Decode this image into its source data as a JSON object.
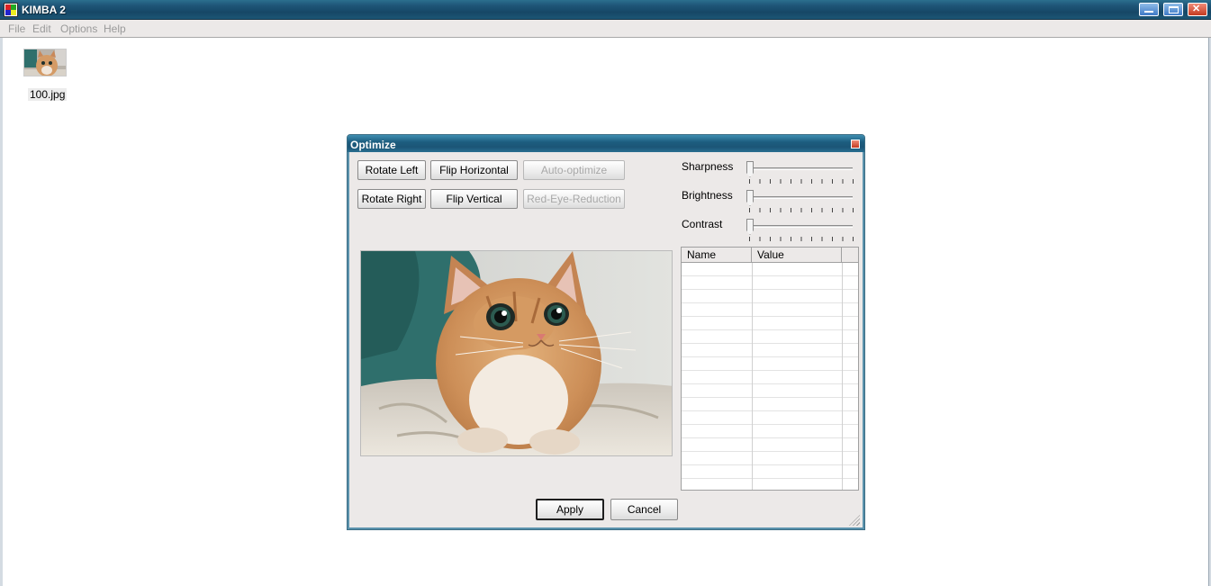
{
  "window": {
    "title": "KIMBA 2",
    "controls": {
      "minimize": "minimize-icon",
      "maximize": "maximize-icon",
      "close": "close-icon"
    }
  },
  "menu": {
    "items": [
      "File",
      "Edit",
      "Options",
      "Help"
    ]
  },
  "thumbnails": [
    {
      "filename": "100.jpg"
    }
  ],
  "dialog": {
    "title": "Optimize",
    "buttons": {
      "rotate_left": "Rotate Left",
      "rotate_right": "Rotate Right",
      "flip_horizontal": "Flip Horizontal",
      "flip_vertical": "Flip Vertical",
      "auto_optimize": "Auto-optimize",
      "red_eye": "Red-Eye-Reduction",
      "apply": "Apply",
      "cancel": "Cancel"
    },
    "sliders": [
      {
        "label": "Sharpness",
        "value": 0
      },
      {
        "label": "Brightness",
        "value": 0
      },
      {
        "label": "Contrast",
        "value": 0
      }
    ],
    "grid": {
      "columns": [
        "Name",
        "Value"
      ],
      "rows": []
    }
  },
  "colors": {
    "titlebar": "#1e5577",
    "dialog_face": "#ece9e8",
    "disabled_text": "#a8a8a8"
  }
}
